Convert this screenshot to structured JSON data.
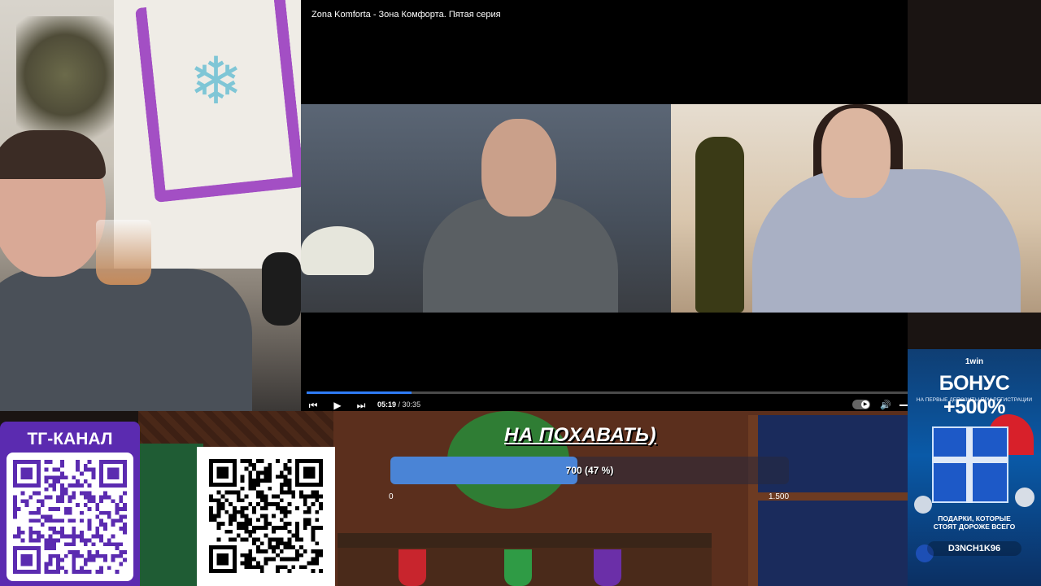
{
  "video": {
    "title": "Zona Komforta - Зона Комфорта. Пятая серия",
    "current_time": "05:19",
    "separator": " / ",
    "total_time": "30:35",
    "progress_fraction": 0.174,
    "controls": {
      "previous_icon": "⏮",
      "play_icon": "▶",
      "next_icon": "⏭",
      "volume_icon": "🔊"
    },
    "accent_color": "#2f7cf6"
  },
  "donation_goal": {
    "headline": "НА ПОХАВАТЬ)",
    "progress_label": "700 (47 %)",
    "progress_fraction": 0.47,
    "min_label": "0",
    "max_label": "1.500"
  },
  "telegram": {
    "title": "ТГ-КАНАЛ"
  },
  "ad": {
    "brand": "1win",
    "headline": "БОНУС +500%",
    "subheadline": "НА ПЕРВЫЕ ДЕПОЗИТЫ ПРИ РЕГИСТРАЦИИ",
    "gifts_line1": "ПОДАРКИ, КОТОРЫЕ",
    "gifts_line2": "СТОЯТ ДОРОЖЕ ВСЕГО",
    "promo_code": "D3NCH1K96"
  }
}
